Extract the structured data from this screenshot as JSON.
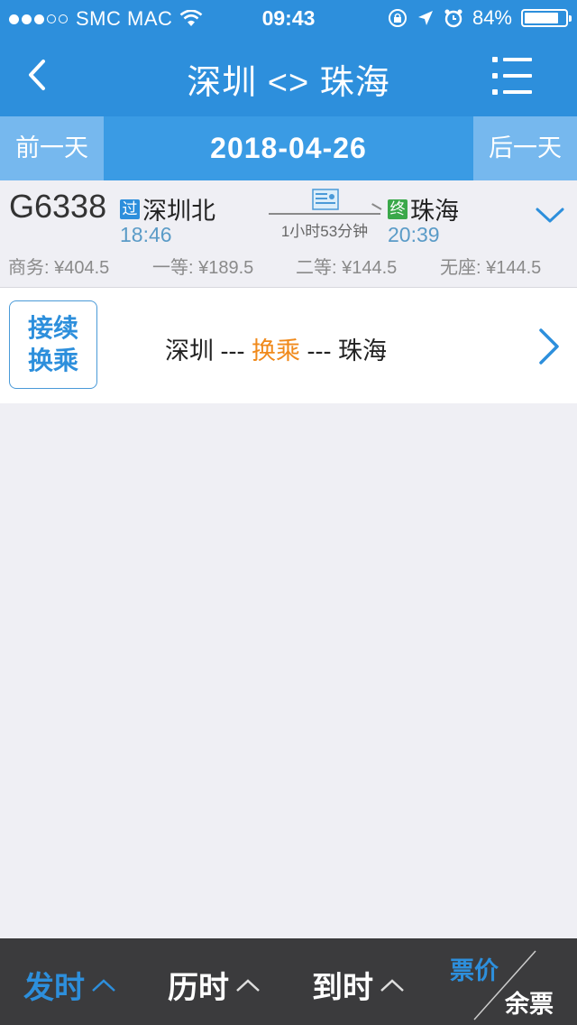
{
  "status_bar": {
    "carrier": "SMC MAC",
    "time": "09:43",
    "battery": "84%",
    "battery_level": 0.84
  },
  "nav": {
    "title": "深圳 <> 珠海"
  },
  "date_bar": {
    "prev_label": "前一天",
    "date": "2018-04-26",
    "next_label": "后一天"
  },
  "train": {
    "number": "G6338",
    "dep_badge": "过",
    "dep_station": "深圳北",
    "dep_time": "18:46",
    "duration": "1小时53分钟",
    "arr_badge": "终",
    "arr_station": "珠海",
    "arr_time": "20:39",
    "prices": [
      {
        "label": "商务: ¥404.5"
      },
      {
        "label": "一等: ¥189.5"
      },
      {
        "label": "二等: ¥144.5"
      },
      {
        "label": "无座: ¥144.5"
      }
    ]
  },
  "transfer": {
    "button_line1": "接续",
    "button_line2": "换乘",
    "from": "深圳 --- ",
    "middle": "换乘",
    "to": " --- 珠海"
  },
  "bottom_bar": {
    "sort_depart": "发时",
    "sort_duration": "历时",
    "sort_arrive": "到时",
    "price": "票价",
    "remaining": "余票",
    "active_color": "#2d8fdc"
  }
}
